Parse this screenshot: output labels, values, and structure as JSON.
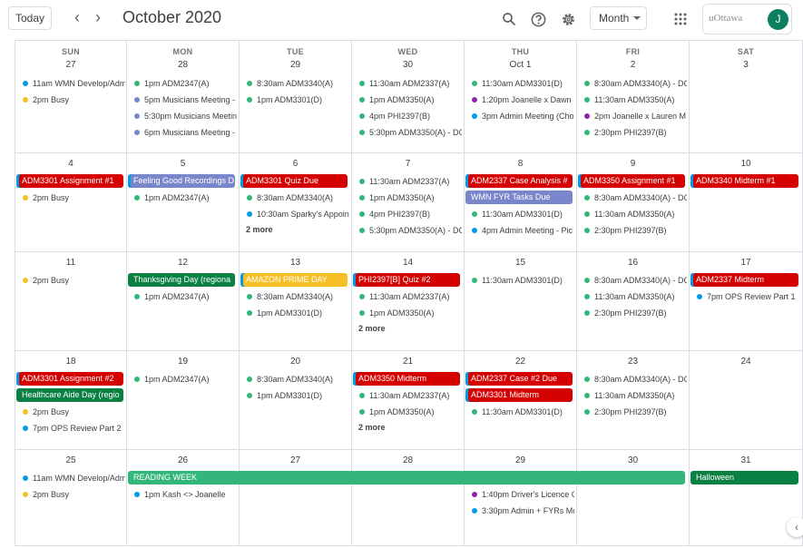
{
  "header": {
    "today_label": "Today",
    "prev_icon": "chevron-left-icon",
    "next_icon": "chevron-right-icon",
    "title": "October 2020",
    "view_label": "Month",
    "account_logo": "uOttawa",
    "avatar_letter": "J"
  },
  "colors": {
    "blue": "#039be5",
    "yellow": "#f6bf26",
    "green": "#33b679",
    "lavender": "#7986cb",
    "purple": "#8e24aa",
    "red": "#d50000",
    "dkgreen": "#0b8043",
    "teal": "#33b679",
    "amber": "#f6bf26"
  },
  "days_of_week": [
    "SUN",
    "MON",
    "TUE",
    "WED",
    "THU",
    "FRI",
    "SAT"
  ],
  "weeks": [
    {
      "days": [
        {
          "n": "27",
          "events": [
            {
              "t": "11am WMN Develop/Adm",
              "c": "blue"
            },
            {
              "t": "2pm Busy",
              "c": "yellow"
            }
          ]
        },
        {
          "n": "28",
          "events": [
            {
              "t": "1pm ADM2347(A)",
              "c": "green"
            },
            {
              "t": "5pm Musicians Meeting -",
              "c": "lavender"
            },
            {
              "t": "5:30pm Musicians Meetin",
              "c": "lavender"
            },
            {
              "t": "6pm Musicians Meeting -",
              "c": "lavender"
            }
          ]
        },
        {
          "n": "29",
          "events": [
            {
              "t": "8:30am ADM3340(A)",
              "c": "green"
            },
            {
              "t": "1pm ADM3301(D)",
              "c": "green"
            }
          ]
        },
        {
          "n": "30",
          "events": [
            {
              "t": "11:30am ADM2337(A)",
              "c": "green"
            },
            {
              "t": "1pm ADM3350(A)",
              "c": "green"
            },
            {
              "t": "4pm PHI2397(B)",
              "c": "green"
            },
            {
              "t": "5:30pm ADM3350(A) - DC",
              "c": "green"
            }
          ]
        },
        {
          "n": "Oct 1",
          "events": [
            {
              "t": "11:30am ADM3301(D)",
              "c": "green"
            },
            {
              "t": "1:20pm Joanelle x Dawn",
              "c": "purple"
            },
            {
              "t": "3pm Admin Meeting (Cho",
              "c": "blue"
            }
          ]
        },
        {
          "n": "2",
          "events": [
            {
              "t": "8:30am ADM3340(A) - DC",
              "c": "green"
            },
            {
              "t": "11:30am ADM3350(A)",
              "c": "green"
            },
            {
              "t": "2pm Joanelle x Lauren M",
              "c": "purple"
            },
            {
              "t": "2:30pm PHI2397(B)",
              "c": "green"
            }
          ]
        },
        {
          "n": "3",
          "events": []
        }
      ]
    },
    {
      "days": [
        {
          "n": "4",
          "chips": [
            {
              "t": "ADM3301 Assignment #1",
              "c": "red",
              "accent": true
            }
          ],
          "events": [
            {
              "t": "2pm Busy",
              "c": "yellow"
            }
          ]
        },
        {
          "n": "5",
          "chips": [
            {
              "t": "Feeling Good Recordings D",
              "c": "lavender",
              "accent": true
            }
          ],
          "events": [
            {
              "t": "1pm ADM2347(A)",
              "c": "green"
            }
          ]
        },
        {
          "n": "6",
          "chips": [
            {
              "t": "ADM3301 Quiz Due",
              "c": "red",
              "accent": true
            }
          ],
          "events": [
            {
              "t": "8:30am ADM3340(A)",
              "c": "green"
            },
            {
              "t": "10:30am Sparky's Appoin",
              "c": "blue"
            }
          ],
          "more": "2 more"
        },
        {
          "n": "7",
          "events": [
            {
              "t": "11:30am ADM2337(A)",
              "c": "green"
            },
            {
              "t": "1pm ADM3350(A)",
              "c": "green"
            },
            {
              "t": "4pm PHI2397(B)",
              "c": "green"
            },
            {
              "t": "5:30pm ADM3350(A) - DC",
              "c": "green"
            }
          ]
        },
        {
          "n": "8",
          "chips": [
            {
              "t": "ADM2337 Case Analysis #",
              "c": "red",
              "accent": true
            },
            {
              "t": "WMN FYR Tasks Due",
              "c": "lavender"
            }
          ],
          "events": [
            {
              "t": "11:30am ADM3301(D)",
              "c": "green"
            },
            {
              "t": "4pm Admin Meeting - Pic",
              "c": "blue"
            }
          ]
        },
        {
          "n": "9",
          "chips": [
            {
              "t": "ADM3350 Assignment #1",
              "c": "red",
              "accent": true
            }
          ],
          "events": [
            {
              "t": "8:30am ADM3340(A) - DC",
              "c": "green"
            },
            {
              "t": "11:30am ADM3350(A)",
              "c": "green"
            },
            {
              "t": "2:30pm PHI2397(B)",
              "c": "green"
            }
          ]
        },
        {
          "n": "10",
          "chips": [
            {
              "t": "ADM3340 Midterm #1",
              "c": "red",
              "accent": true
            }
          ],
          "events": []
        }
      ]
    },
    {
      "days": [
        {
          "n": "11",
          "events": [
            {
              "t": "2pm Busy",
              "c": "yellow"
            }
          ]
        },
        {
          "n": "12",
          "chips": [
            {
              "t": "Thanksgiving Day (regiona",
              "c": "dkgreen"
            }
          ],
          "events": [
            {
              "t": "1pm ADM2347(A)",
              "c": "green"
            }
          ]
        },
        {
          "n": "13",
          "chips": [
            {
              "t": "AMAZON PRIME DAY",
              "c": "amber",
              "accent": true
            }
          ],
          "events": [
            {
              "t": "8:30am ADM3340(A)",
              "c": "green"
            },
            {
              "t": "1pm ADM3301(D)",
              "c": "green"
            }
          ]
        },
        {
          "n": "14",
          "chips": [
            {
              "t": "PHI2397[B] Quiz #2",
              "c": "red",
              "accent": true
            }
          ],
          "events": [
            {
              "t": "11:30am ADM2337(A)",
              "c": "green"
            },
            {
              "t": "1pm ADM3350(A)",
              "c": "green"
            }
          ],
          "more": "2 more"
        },
        {
          "n": "15",
          "events": [
            {
              "t": "11:30am ADM3301(D)",
              "c": "green"
            }
          ]
        },
        {
          "n": "16",
          "events": [
            {
              "t": "8:30am ADM3340(A) - DC",
              "c": "green"
            },
            {
              "t": "11:30am ADM3350(A)",
              "c": "green"
            },
            {
              "t": "2:30pm PHI2397(B)",
              "c": "green"
            }
          ]
        },
        {
          "n": "17",
          "chips": [
            {
              "t": "ADM2337 Midterm",
              "c": "red",
              "accent": true
            }
          ],
          "events": [
            {
              "t": "7pm OPS Review Part 1",
              "c": "blue"
            }
          ]
        }
      ]
    },
    {
      "days": [
        {
          "n": "18",
          "chips": [
            {
              "t": "ADM3301 Assignment #2",
              "c": "red",
              "accent": true
            },
            {
              "t": "Healthcare Aide Day (regio",
              "c": "dkgreen"
            }
          ],
          "events": [
            {
              "t": "2pm Busy",
              "c": "yellow"
            },
            {
              "t": "7pm OPS Review Part 2",
              "c": "blue"
            }
          ]
        },
        {
          "n": "19",
          "events": [
            {
              "t": "1pm ADM2347(A)",
              "c": "green"
            }
          ]
        },
        {
          "n": "20",
          "events": [
            {
              "t": "8:30am ADM3340(A)",
              "c": "green"
            },
            {
              "t": "1pm ADM3301(D)",
              "c": "green"
            }
          ]
        },
        {
          "n": "21",
          "chips": [
            {
              "t": "ADM3350 Midterm",
              "c": "red",
              "accent": true
            }
          ],
          "events": [
            {
              "t": "11:30am ADM2337(A)",
              "c": "green"
            },
            {
              "t": "1pm ADM3350(A)",
              "c": "green"
            }
          ],
          "more": "2 more"
        },
        {
          "n": "22",
          "chips": [
            {
              "t": "ADM2337 Case #2 Due",
              "c": "red",
              "accent": true
            },
            {
              "t": "ADM3301 Midterm",
              "c": "red",
              "accent": true
            }
          ],
          "events": [
            {
              "t": "11:30am ADM3301(D)",
              "c": "green"
            }
          ]
        },
        {
          "n": "23",
          "events": [
            {
              "t": "8:30am ADM3340(A) - DC",
              "c": "green"
            },
            {
              "t": "11:30am ADM3350(A)",
              "c": "green"
            },
            {
              "t": "2:30pm PHI2397(B)",
              "c": "green"
            }
          ]
        },
        {
          "n": "24",
          "events": []
        }
      ]
    },
    {
      "span": {
        "t": "READING WEEK",
        "c": "teal",
        "from": 1,
        "to": 5
      },
      "days": [
        {
          "n": "25",
          "events": [
            {
              "t": "11am WMN Develop/Adm",
              "c": "blue"
            },
            {
              "t": "2pm Busy",
              "c": "yellow"
            }
          ]
        },
        {
          "n": "26",
          "events": [
            {
              "t": "1pm Kash <> Joanelle",
              "c": "blue"
            }
          ]
        },
        {
          "n": "27",
          "events": []
        },
        {
          "n": "28",
          "events": []
        },
        {
          "n": "29",
          "events": [
            {
              "t": "1:40pm Driver's Licence C",
              "c": "purple"
            },
            {
              "t": "3:30pm Admin + FYRs Mo",
              "c": "blue"
            }
          ]
        },
        {
          "n": "30",
          "events": []
        },
        {
          "n": "31",
          "chips": [
            {
              "t": "Halloween",
              "c": "dkgreen"
            }
          ],
          "events": []
        }
      ]
    }
  ]
}
